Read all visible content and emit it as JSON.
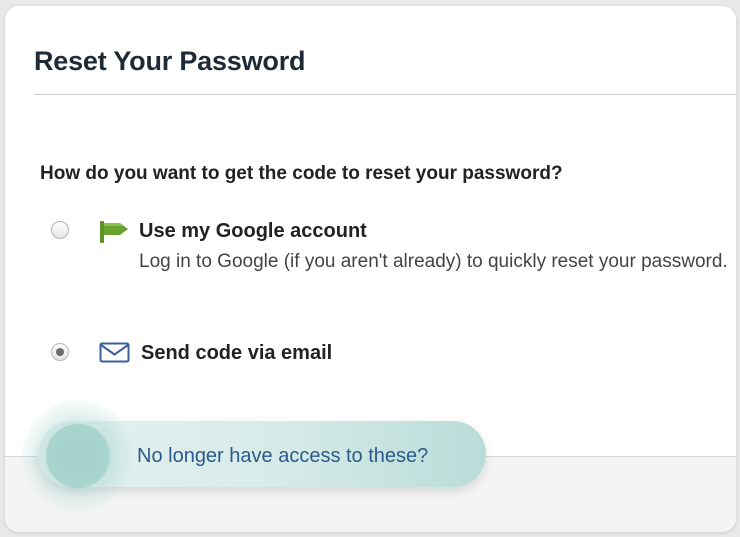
{
  "header": {
    "title": "Reset Your Password"
  },
  "question": "How do you want to get the code to reset your password?",
  "options": [
    {
      "icon": "google-flag-icon",
      "title": "Use my Google account",
      "description": "Log in to Google (if you aren't already) to quickly reset your password.",
      "selected": false
    },
    {
      "icon": "envelope-icon",
      "title": "Send code via email",
      "selected": true
    }
  ],
  "footer": {
    "access_link": "No longer have access to these?"
  },
  "colors": {
    "flag_green": "#6aa12f",
    "envelope_blue": "#3b5f9e",
    "link_blue": "#2c5a8a",
    "highlight_teal": "#9fcfc9"
  }
}
